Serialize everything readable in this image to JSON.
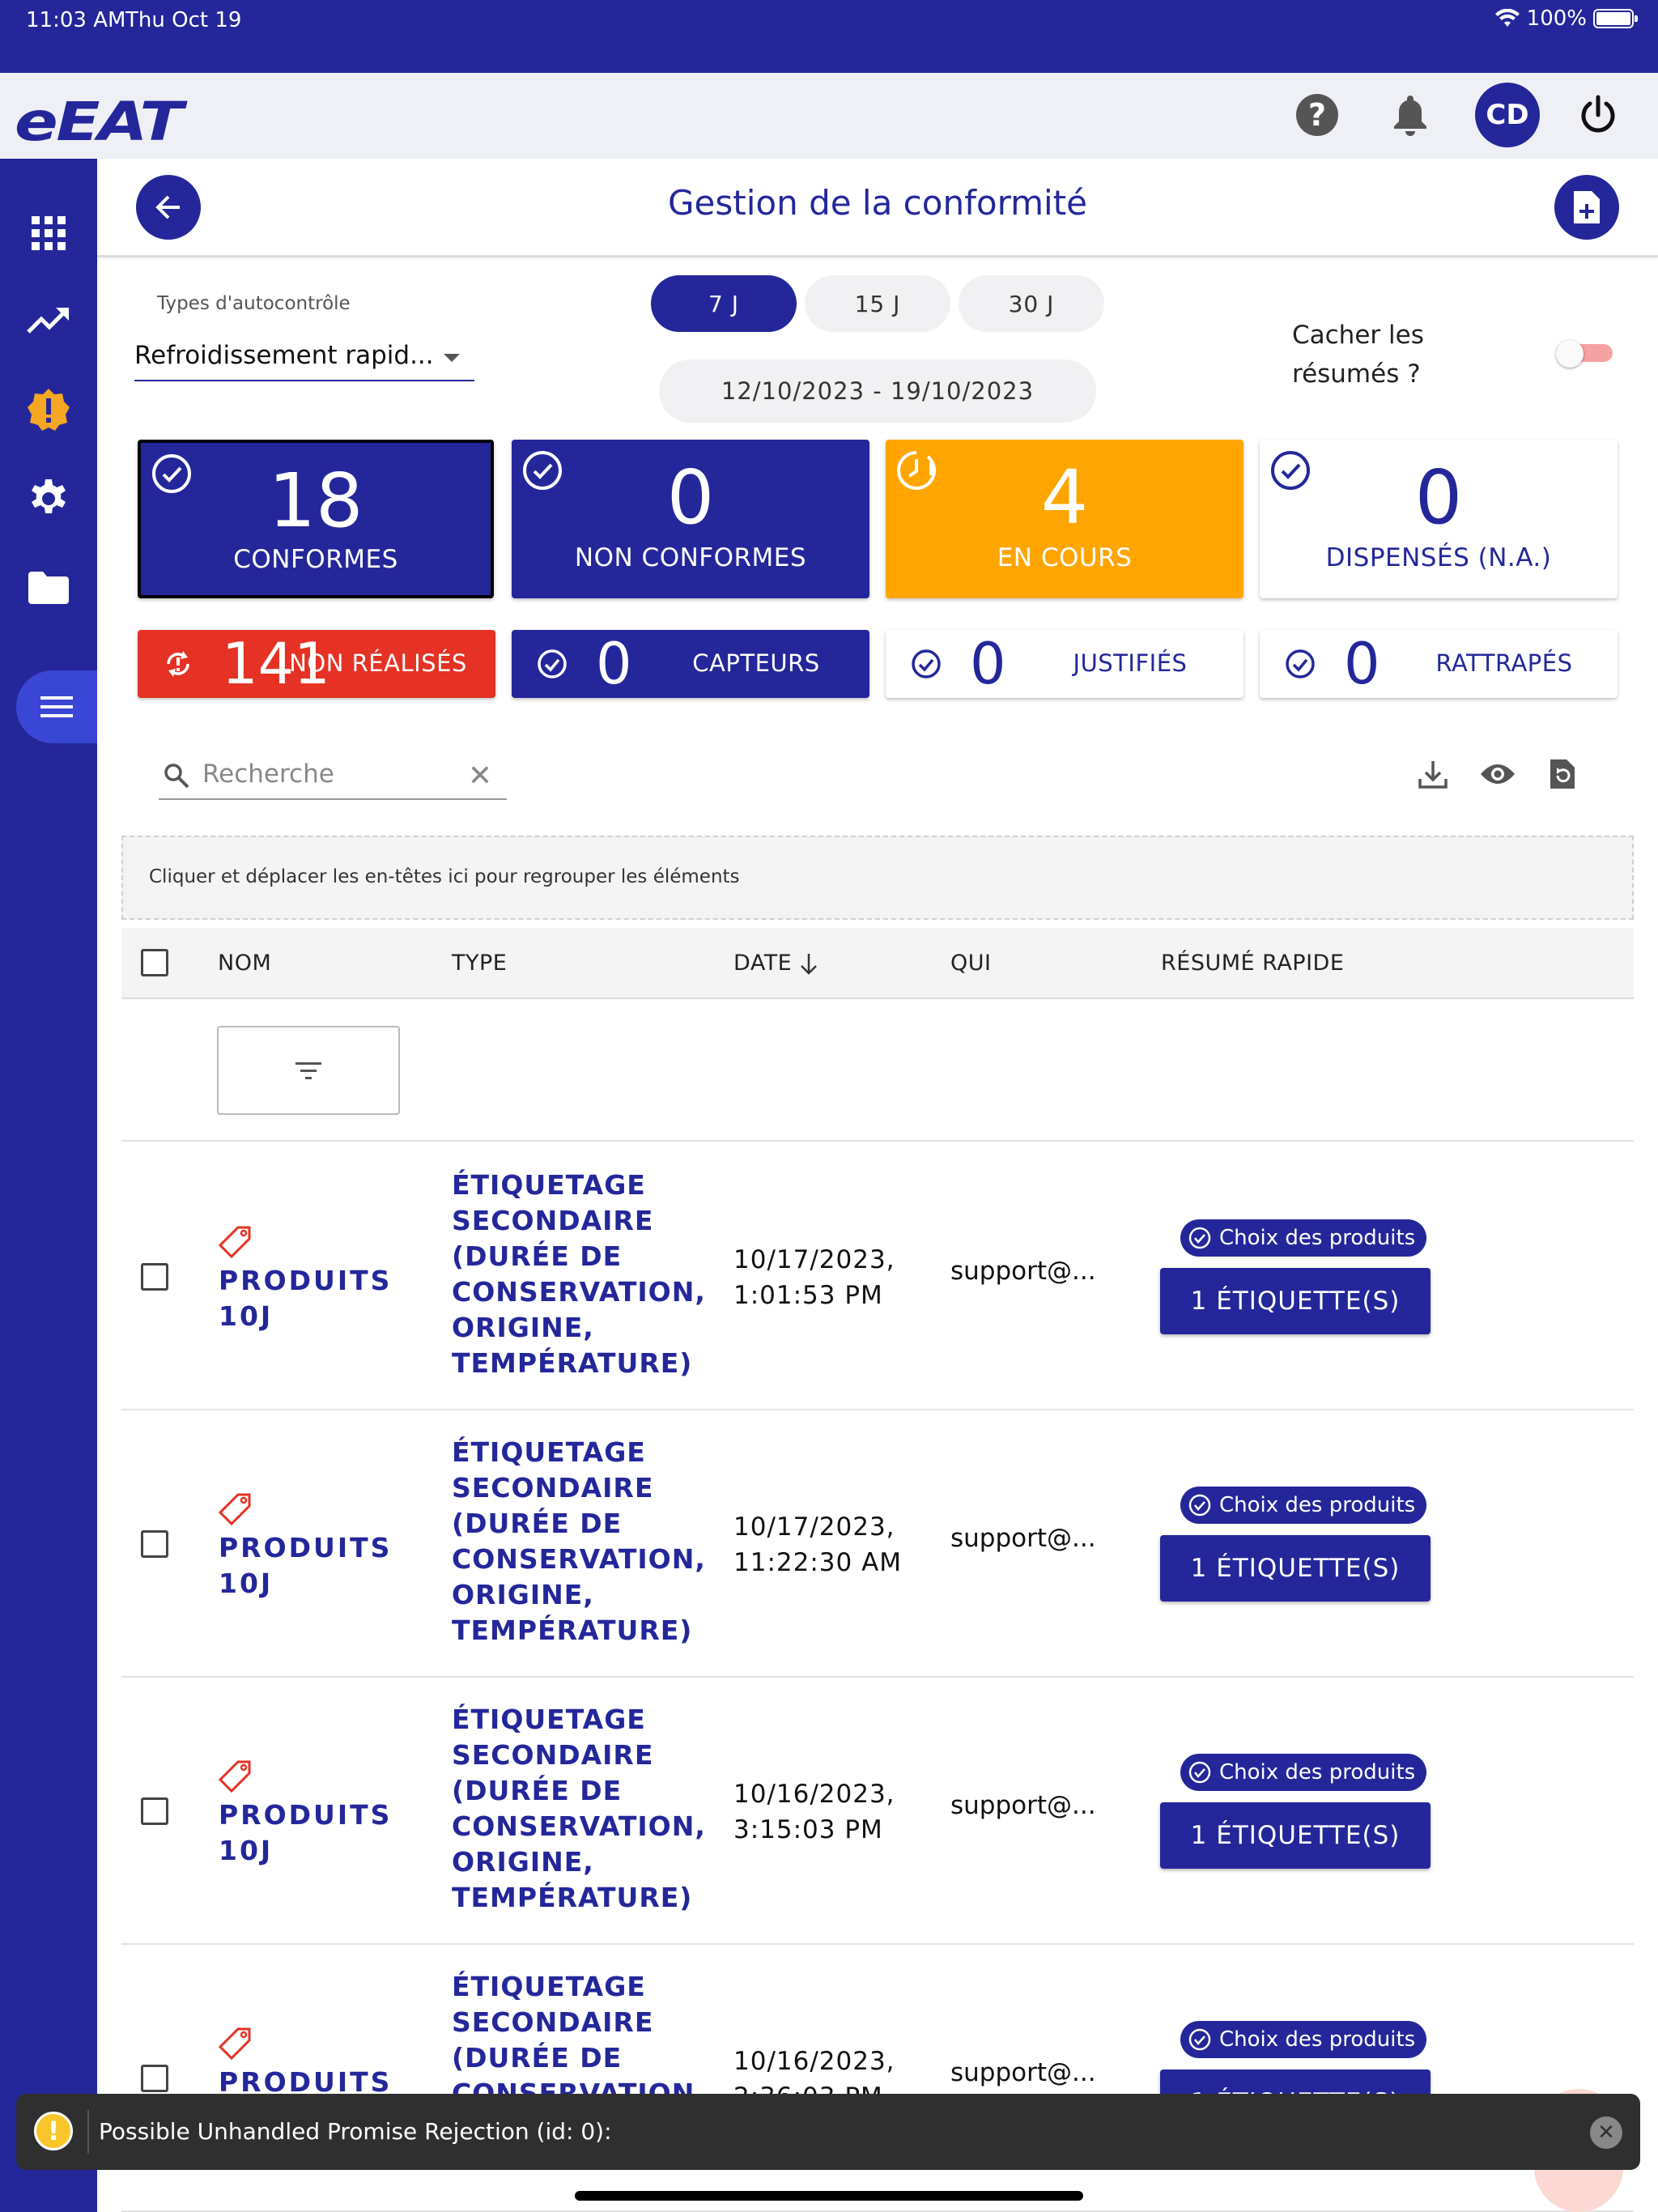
{
  "status_bar": {
    "time": "11:03 AM",
    "date": "Thu Oct 19",
    "battery": "100%"
  },
  "header": {
    "logo": "eEAT",
    "avatar_initials": "CD"
  },
  "page": {
    "title": "Gestion de la conformité"
  },
  "filters": {
    "types_label": "Types d'autocontrôle",
    "types_value": "Refroidissement rapid...",
    "periods": [
      "7 J",
      "15 J",
      "30 J"
    ],
    "selected_period": "7 J",
    "date_range": "12/10/2023 - 19/10/2023",
    "hide_summaries_label": "Cacher les résumés ?"
  },
  "stats": {
    "conformes": {
      "value": "18",
      "label": "CONFORMES"
    },
    "non_conformes": {
      "value": "0",
      "label": "NON CONFORMES"
    },
    "en_cours": {
      "value": "4",
      "label": "EN COURS"
    },
    "dispenses": {
      "value": "0",
      "label": "DISPENSÉS (N.A.)"
    },
    "non_realises": {
      "value": "141",
      "label": "NON RÉALISÉS"
    },
    "capteurs": {
      "value": "0",
      "label": "CAPTEURS"
    },
    "justifies": {
      "value": "0",
      "label": "JUSTIFIÉS"
    },
    "rattrapes": {
      "value": "0",
      "label": "RATTRAPÉS"
    }
  },
  "search": {
    "placeholder": "Recherche"
  },
  "grid": {
    "group_hint": "Cliquer et déplacer les en-têtes ici pour regrouper les éléments",
    "columns": [
      "NOM",
      "TYPE",
      "DATE",
      "QUI",
      "RÉSUMÉ RAPIDE"
    ],
    "rows": [
      {
        "name_line1": "PRODUITS",
        "name_line2": "10J",
        "type": "ÉTIQUETAGE SECONDAIRE (DURÉE DE CONSERVATION, ORIGINE, TEMPÉRATURE)",
        "date_line1": "10/17/2023,",
        "date_line2": "1:01:53 PM",
        "qui": "support@...",
        "chip": "Choix des produits",
        "button": "1 ÉTIQUETTE(S)"
      },
      {
        "name_line1": "PRODUITS",
        "name_line2": "10J",
        "type": "ÉTIQUETAGE SECONDAIRE (DURÉE DE CONSERVATION, ORIGINE, TEMPÉRATURE)",
        "date_line1": "10/17/2023,",
        "date_line2": "11:22:30 AM",
        "qui": "support@...",
        "chip": "Choix des produits",
        "button": "1 ÉTIQUETTE(S)"
      },
      {
        "name_line1": "PRODUITS",
        "name_line2": "10J",
        "type": "ÉTIQUETAGE SECONDAIRE (DURÉE DE CONSERVATION, ORIGINE, TEMPÉRATURE)",
        "date_line1": "10/16/2023,",
        "date_line2": "3:15:03 PM",
        "qui": "support@...",
        "chip": "Choix des produits",
        "button": "1 ÉTIQUETTE(S)"
      },
      {
        "name_line1": "PRODUITS",
        "name_line2": "",
        "type": "ÉTIQUETAGE SECONDAIRE (DURÉE DE CONSERVATION",
        "date_line1": "10/16/2023,",
        "date_line2": "2:36:03 PM",
        "qui": "support@...",
        "chip": "Choix des produits",
        "button": "1 ÉTIQUETTE(S)"
      }
    ]
  },
  "toast": {
    "message": "Possible Unhandled Promise Rejection (id: 0):"
  },
  "colors": {
    "primary": "#24279a",
    "warning": "#ffa500",
    "danger": "#e53224",
    "sidebar_active": "#3a46d6"
  },
  "icons": {
    "sidebar": [
      "grid-icon",
      "trending-up-icon",
      "alert-badge-icon",
      "gear-icon",
      "folder-icon",
      "menu-icon"
    ],
    "header": [
      "help-icon",
      "bell-icon",
      "power-icon"
    ]
  }
}
